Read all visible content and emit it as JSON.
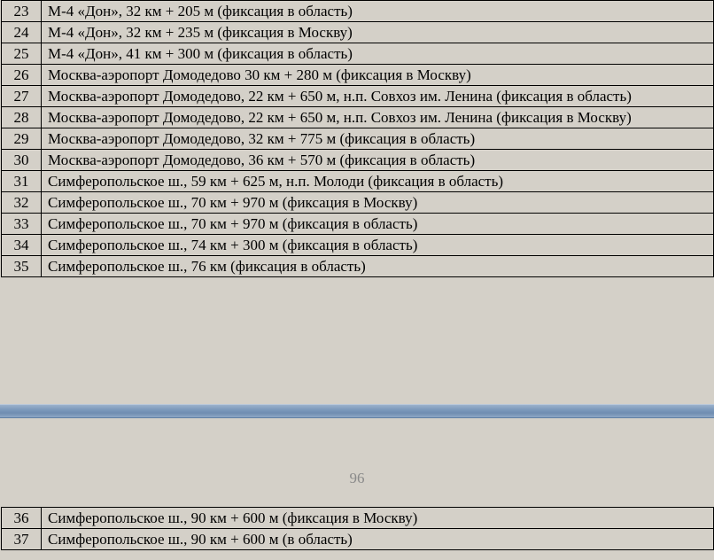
{
  "table_top": {
    "rows": [
      {
        "num": "23",
        "text": "М-4 «Дон», 32 км + 205 м (фиксация в область)"
      },
      {
        "num": "24",
        "text": "М-4 «Дон», 32 км + 235 м (фиксация в Москву)"
      },
      {
        "num": "25",
        "text": "М-4 «Дон», 41 км + 300 м (фиксация в область)"
      },
      {
        "num": "26",
        "text": "Москва-аэропорт Домодедово 30 км + 280 м (фиксация в Москву)"
      },
      {
        "num": "27",
        "text": "Москва-аэропорт Домодедово, 22 км + 650 м, н.п. Совхоз им. Ленина (фиксация в область)"
      },
      {
        "num": "28",
        "text": "Москва-аэропорт Домодедово, 22 км + 650 м, н.п. Совхоз им. Ленина (фиксация в Москву)"
      },
      {
        "num": "29",
        "text": "Москва-аэропорт Домодедово, 32 км + 775 м (фиксация  в область)"
      },
      {
        "num": "30",
        "text": "Москва-аэропорт Домодедово, 36 км + 570 м (фиксация  в область)"
      },
      {
        "num": "31",
        "text": "Симферопольское ш., 59 км + 625 м, н.п. Молоди (фиксация в область)"
      },
      {
        "num": "32",
        "text": "Симферопольское ш., 70 км + 970 м (фиксация в Москву)"
      },
      {
        "num": "33",
        "text": "Симферопольское ш., 70 км + 970 м (фиксация в область)"
      },
      {
        "num": "34",
        "text": "Симферопольское ш., 74 км + 300 м (фиксация в область)"
      },
      {
        "num": "35",
        "text": "Симферопольское ш., 76 км (фиксация  в область)"
      }
    ]
  },
  "page_number": "96",
  "table_bottom": {
    "rows": [
      {
        "num": "36",
        "text": "Симферопольское ш., 90 км + 600 м (фиксация в Москву)"
      },
      {
        "num": "37",
        "text": "Симферопольское ш., 90 км + 600 м (в область)"
      }
    ]
  }
}
